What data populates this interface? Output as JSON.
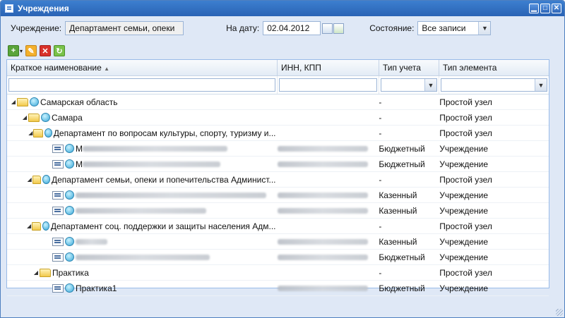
{
  "window": {
    "title": "Учреждения"
  },
  "filters": {
    "institution_label": "Учреждение:",
    "institution_value": "Департамент семьи, опеки",
    "date_label": "На дату:",
    "date_value": "02.04.2012",
    "state_label": "Состояние:",
    "state_value": "Все записи"
  },
  "toolbar": {
    "icons": [
      "add-icon",
      "edit-icon",
      "delete-icon",
      "refresh-icon"
    ]
  },
  "grid": {
    "columns": [
      "Краткое наименование",
      "ИНН, КПП",
      "Тип учета",
      "Тип элемента"
    ],
    "rows": [
      {
        "name": "Самарская область",
        "inn": "",
        "accounting": "-",
        "element": "Простой узел"
      },
      {
        "name": "Самара",
        "inn": "",
        "accounting": "-",
        "element": "Простой узел"
      },
      {
        "name": "Департамент по вопросам культуры, спорту, туризму и...",
        "inn": "",
        "accounting": "-",
        "element": "Простой узел"
      },
      {
        "name": "М",
        "inn": "",
        "accounting": "Бюджетный",
        "element": "Учреждение"
      },
      {
        "name": "М",
        "inn": "",
        "accounting": "Бюджетный",
        "element": "Учреждение"
      },
      {
        "name": "Департамент семьи, опеки и попечительства Админист...",
        "inn": "",
        "accounting": "-",
        "element": "Простой узел"
      },
      {
        "name": "",
        "inn": "",
        "accounting": "Казенный",
        "element": "Учреждение"
      },
      {
        "name": "",
        "inn": "",
        "accounting": "Казенный",
        "element": "Учреждение"
      },
      {
        "name": "Департамент соц. поддержки и защиты населения Адм...",
        "inn": "",
        "accounting": "-",
        "element": "Простой узел"
      },
      {
        "name": "",
        "inn": "",
        "accounting": "Казенный",
        "element": "Учреждение"
      },
      {
        "name": "",
        "inn": "",
        "accounting": "Бюджетный",
        "element": "Учреждение"
      },
      {
        "name": "Практика",
        "inn": "",
        "accounting": "-",
        "element": "Простой узел"
      },
      {
        "name": "Практика1",
        "inn": "",
        "accounting": "Бюджетный",
        "element": "Учреждение"
      }
    ]
  },
  "colors": {
    "title_bar": "#2f6bbd",
    "window_bg": "#dfe8f6",
    "grid_border": "#99bbe8"
  }
}
